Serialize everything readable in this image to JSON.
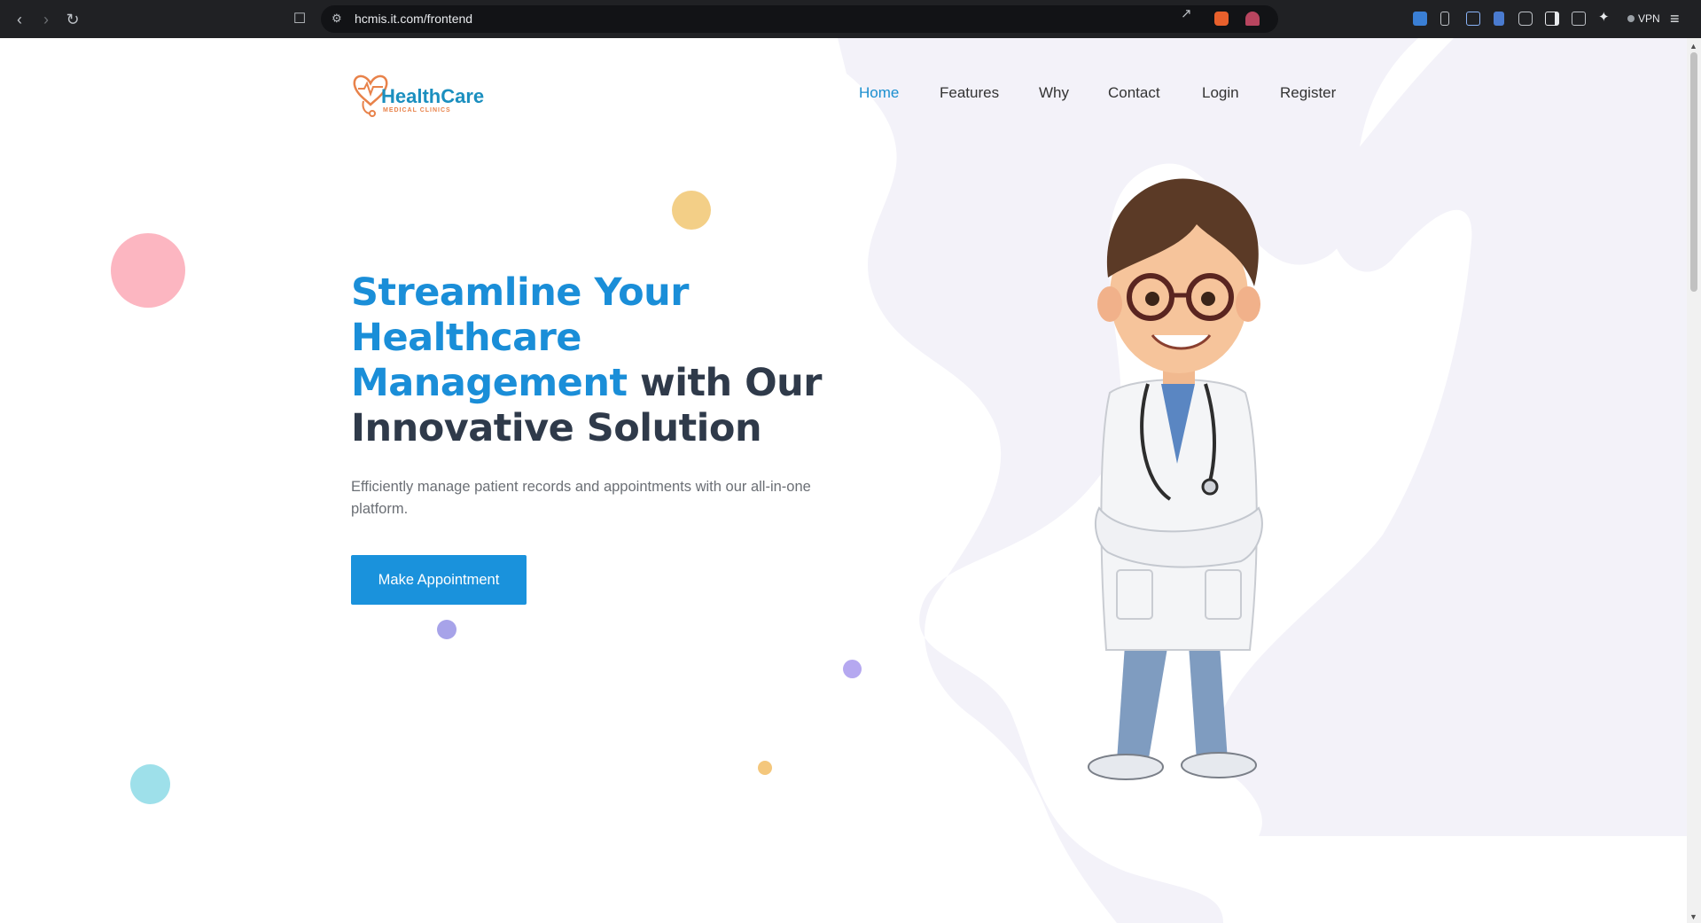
{
  "browser": {
    "url": "hcmis.it.com/frontend",
    "vpn_label": "VPN"
  },
  "header": {
    "logo_name": "HealthCare",
    "logo_sub": "MEDICAL CLINICS",
    "nav": [
      {
        "label": "Home",
        "active": true
      },
      {
        "label": "Features",
        "active": false
      },
      {
        "label": "Why",
        "active": false
      },
      {
        "label": "Contact",
        "active": false
      },
      {
        "label": "Login",
        "active": false
      },
      {
        "label": "Register",
        "active": false
      }
    ]
  },
  "hero": {
    "title_accent": "Streamline Your Healthcare Management",
    "title_rest": "with Our Innovative Solution",
    "description": "Efficiently manage patient records and appointments with our all-in-one platform.",
    "cta_label": "Make Appointment"
  },
  "colors": {
    "accent": "#1a8ed8",
    "title_dark": "#2f3a4a",
    "blob": "#f2f1f8"
  }
}
